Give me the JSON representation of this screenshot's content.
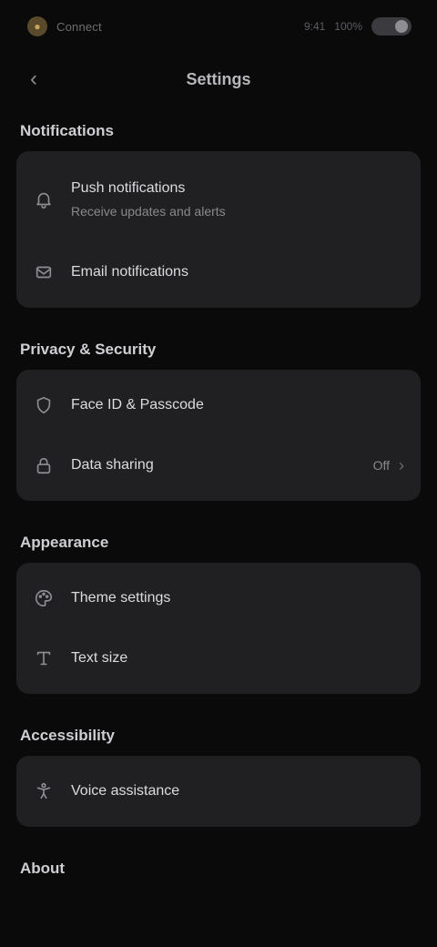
{
  "status_bar": {
    "app_name": "Connect",
    "time": "9:41",
    "battery": "100%"
  },
  "nav": {
    "back_label": "‹",
    "title": "Settings"
  },
  "sections": [
    {
      "title": "Notifications",
      "items": [
        {
          "label": "Push notifications",
          "sub": "Receive updates and alerts",
          "value": "",
          "icon": "bell-icon"
        },
        {
          "label": "Email notifications",
          "sub": "",
          "value": "",
          "icon": "mail-icon"
        }
      ]
    },
    {
      "title": "Privacy & Security",
      "items": [
        {
          "label": "Face ID & Passcode",
          "sub": "",
          "value": "",
          "icon": "shield-icon"
        },
        {
          "label": "Data sharing",
          "sub": "",
          "value": "Off",
          "icon": "lock-icon"
        }
      ]
    },
    {
      "title": "Appearance",
      "items": [
        {
          "label": "Theme settings",
          "sub": "",
          "value": "",
          "icon": "palette-icon"
        },
        {
          "label": "Text size",
          "sub": "",
          "value": "",
          "icon": "text-icon"
        }
      ]
    },
    {
      "title": "Accessibility",
      "items": [
        {
          "label": "Voice assistance",
          "sub": "",
          "value": "",
          "icon": "accessibility-icon"
        }
      ]
    },
    {
      "title": "About",
      "items": []
    }
  ]
}
